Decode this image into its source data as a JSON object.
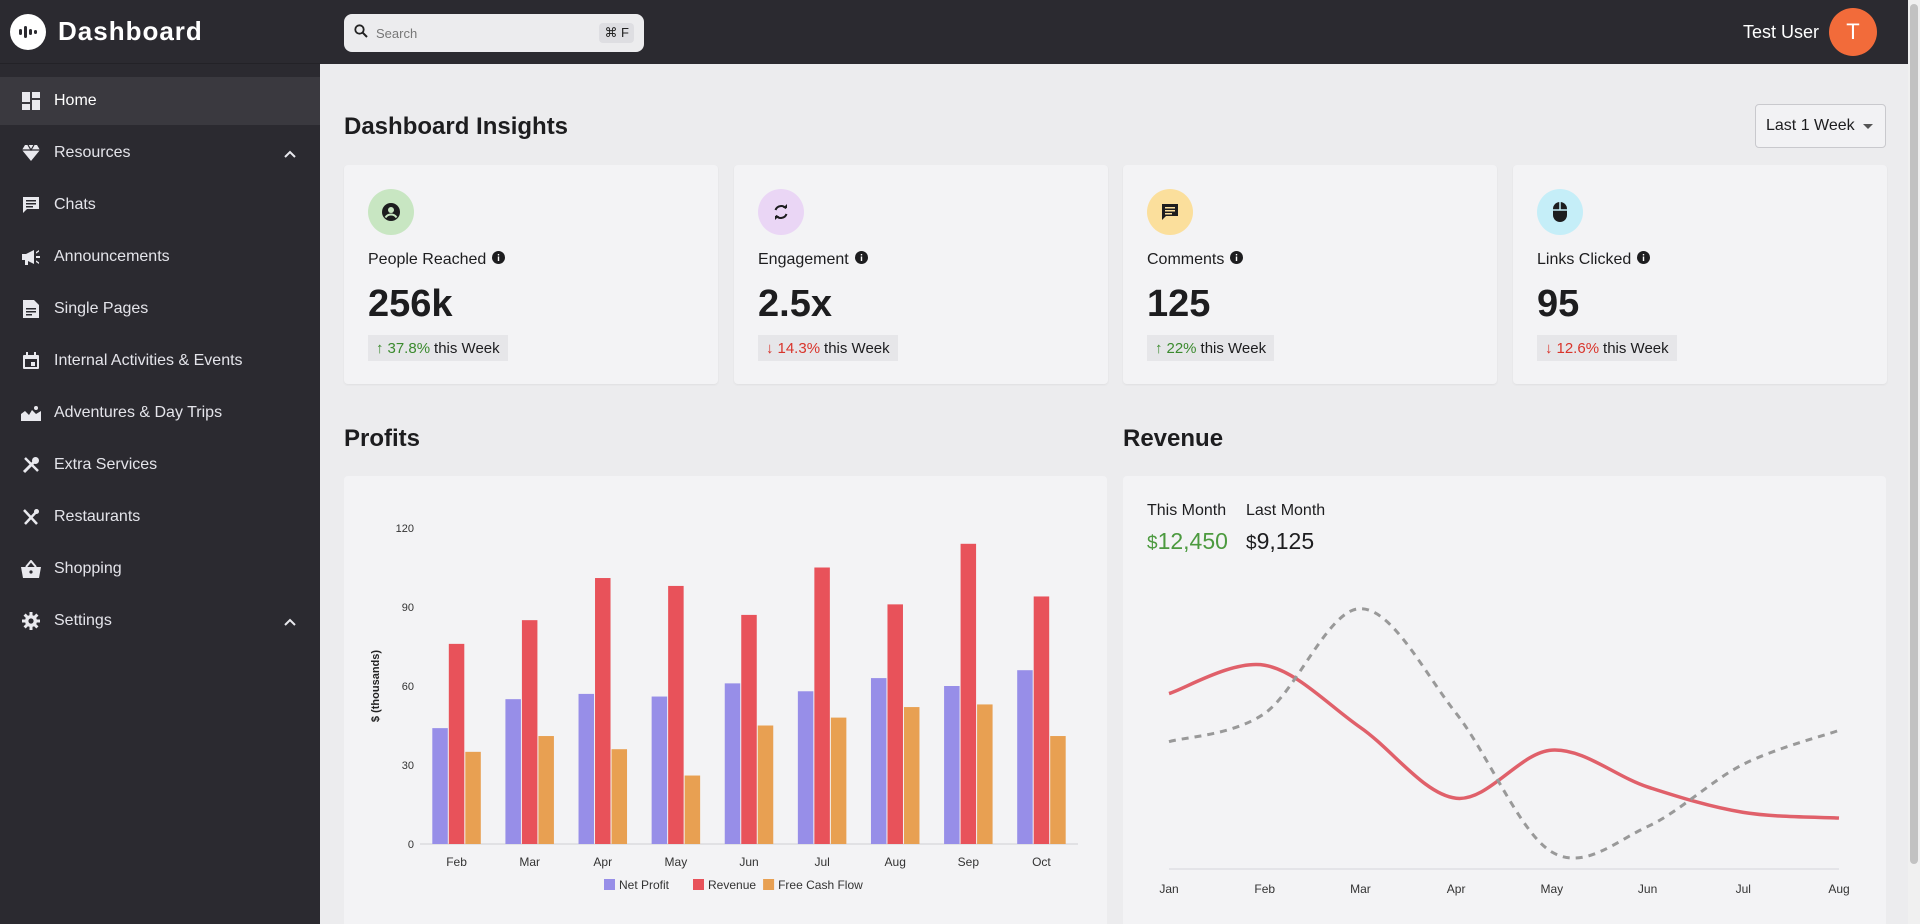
{
  "app": {
    "title": "Dashboard"
  },
  "sidebar": {
    "items": [
      {
        "label": "Home",
        "icon": "dashboard-icon",
        "active": true
      },
      {
        "label": "Resources",
        "icon": "gem-icon",
        "expandable": true
      },
      {
        "label": "Chats",
        "icon": "chat-icon"
      },
      {
        "label": "Announcements",
        "icon": "megaphone-icon"
      },
      {
        "label": "Single Pages",
        "icon": "document-icon"
      },
      {
        "label": "Internal Activities & Events",
        "icon": "calendar-icon"
      },
      {
        "label": "Adventures & Day Trips",
        "icon": "landscape-icon"
      },
      {
        "label": "Extra Services",
        "icon": "tools-icon"
      },
      {
        "label": "Restaurants",
        "icon": "utensils-icon"
      },
      {
        "label": "Shopping",
        "icon": "basket-icon"
      },
      {
        "label": "Settings",
        "icon": "gear-icon",
        "expandable": true
      }
    ]
  },
  "topbar": {
    "search": {
      "placeholder": "Search",
      "shortcut": "⌘ F"
    },
    "user": {
      "name": "Test User",
      "initial": "T",
      "avatar_color": "#f26b3a"
    }
  },
  "main": {
    "title": "Dashboard Insights",
    "range": "Last 1 Week",
    "cards": [
      {
        "label": "People Reached",
        "value": "256k",
        "trend": "up",
        "pct": "37.8%",
        "suffix": "this Week",
        "badge_color": "#c8e6c2",
        "icon": "person-icon"
      },
      {
        "label": "Engagement",
        "value": "2.5x",
        "trend": "down",
        "pct": "14.3%",
        "suffix": "this Week",
        "badge_color": "#ead6f5",
        "icon": "refresh-icon"
      },
      {
        "label": "Comments",
        "value": "125",
        "trend": "up",
        "pct": "22%",
        "suffix": "this Week",
        "badge_color": "#fbdf9c",
        "icon": "comment-icon"
      },
      {
        "label": "Links Clicked",
        "value": "95",
        "trend": "down",
        "pct": "12.6%",
        "suffix": "this Week",
        "badge_color": "#c5eef8",
        "icon": "mouse-icon"
      }
    ],
    "profits_title": "Profits",
    "revenue": {
      "title": "Revenue",
      "this_month_label": "This Month",
      "this_month_value": "12,450",
      "last_month_label": "Last Month",
      "last_month_value": "9,125",
      "currency": "$"
    }
  },
  "chart_data": [
    {
      "type": "bar",
      "ylabel": "$ (thousands)",
      "ylim": [
        0,
        120
      ],
      "yticks": [
        0,
        30,
        60,
        90,
        120
      ],
      "categories": [
        "Feb",
        "Mar",
        "Apr",
        "May",
        "Jun",
        "Jul",
        "Aug",
        "Sep",
        "Oct"
      ],
      "series": [
        {
          "name": "Net Profit",
          "color": "#978ee8",
          "values": [
            44,
            55,
            57,
            56,
            61,
            58,
            63,
            60,
            66
          ]
        },
        {
          "name": "Revenue",
          "color": "#e8525a",
          "values": [
            76,
            85,
            101,
            98,
            87,
            105,
            91,
            114,
            94
          ]
        },
        {
          "name": "Free Cash Flow",
          "color": "#e8a052",
          "values": [
            35,
            41,
            36,
            26,
            45,
            48,
            52,
            53,
            41
          ]
        }
      ],
      "legend": "bottom"
    },
    {
      "type": "line",
      "categories": [
        "Jan",
        "Feb",
        "Mar",
        "Apr",
        "May",
        "Jun",
        "Jul",
        "Aug"
      ],
      "ylim": [
        0,
        100
      ],
      "series": [
        {
          "color": "#e0606a",
          "style": "solid",
          "values": [
            62,
            72,
            50,
            25,
            42,
            29,
            20,
            18
          ]
        },
        {
          "color": "#999999",
          "style": "dashed",
          "values": [
            45,
            55,
            92,
            55,
            6,
            15,
            37,
            49
          ]
        }
      ],
      "grid": false
    }
  ]
}
